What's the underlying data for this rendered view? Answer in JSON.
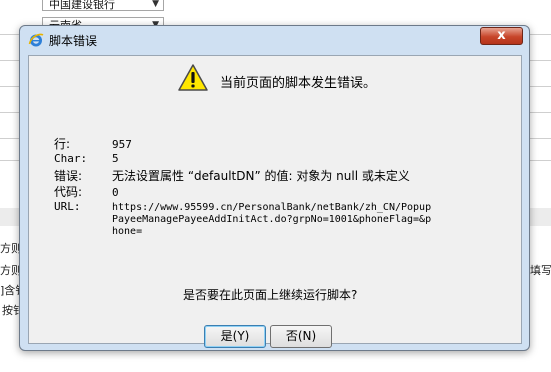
{
  "background": {
    "bank_select": "中国建设银行",
    "province_select": "云南省",
    "left_fragments": [
      "方则",
      "方则",
      "]含钅",
      "按钅"
    ],
    "right_fragments": [
      "填写"
    ]
  },
  "dialog": {
    "title": "脚本错误",
    "close_label": "x",
    "headline": "当前页面的脚本发生错误。",
    "details": {
      "line_label": "行:",
      "line_value": "957",
      "char_label": "Char:",
      "char_value": "5",
      "error_label": "错误:",
      "error_value": "无法设置属性 “defaultDN” 的值: 对象为 null 或未定义",
      "code_label": "代码:",
      "code_value": "0",
      "url_label": "URL:",
      "url_value": "https://www.95599.cn/PersonalBank/netBank/zh_CN/PopupPayeeManagePayeeAddInitAct.do?grpNo=1001&phoneFlag=&phone="
    },
    "question": "是否要在此页面上继续运行脚本?",
    "yes_button": "是(Y)",
    "no_button": "否(N)"
  },
  "colors": {
    "dialog_frame": "#cfe0f2",
    "close_button": "#c7452a",
    "warning_yellow": "#ffe600"
  }
}
